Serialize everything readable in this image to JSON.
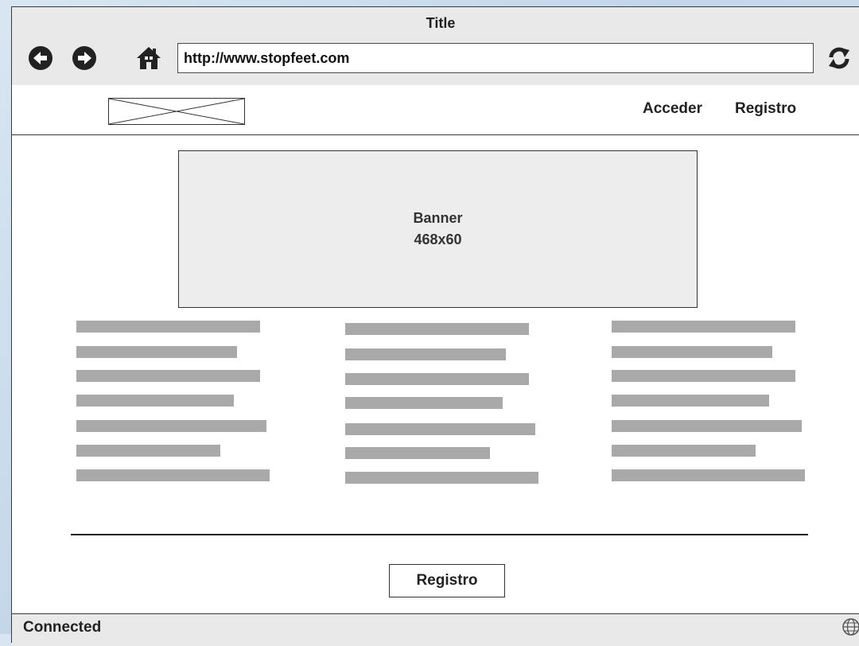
{
  "browser": {
    "title": "Title",
    "url": "http://www.stopfeet.com",
    "icons": [
      "back-icon",
      "forward-icon",
      "home-icon",
      "refresh-icon",
      "globe-icon"
    ]
  },
  "header": {
    "logo": "image-placeholder",
    "links": [
      "Acceder",
      "Registro"
    ]
  },
  "banner": {
    "label": "Banner",
    "size": "468x60"
  },
  "content": {
    "columns": 3,
    "lines_per_column": 7,
    "placeholder_color": "#a9a9a9"
  },
  "footer": {
    "button_label": "Registro"
  },
  "status": {
    "text": "Connected"
  },
  "colors": {
    "chrome": "#e9e9e9",
    "banner_fill": "#ededed",
    "border": "#3a3a3a"
  }
}
